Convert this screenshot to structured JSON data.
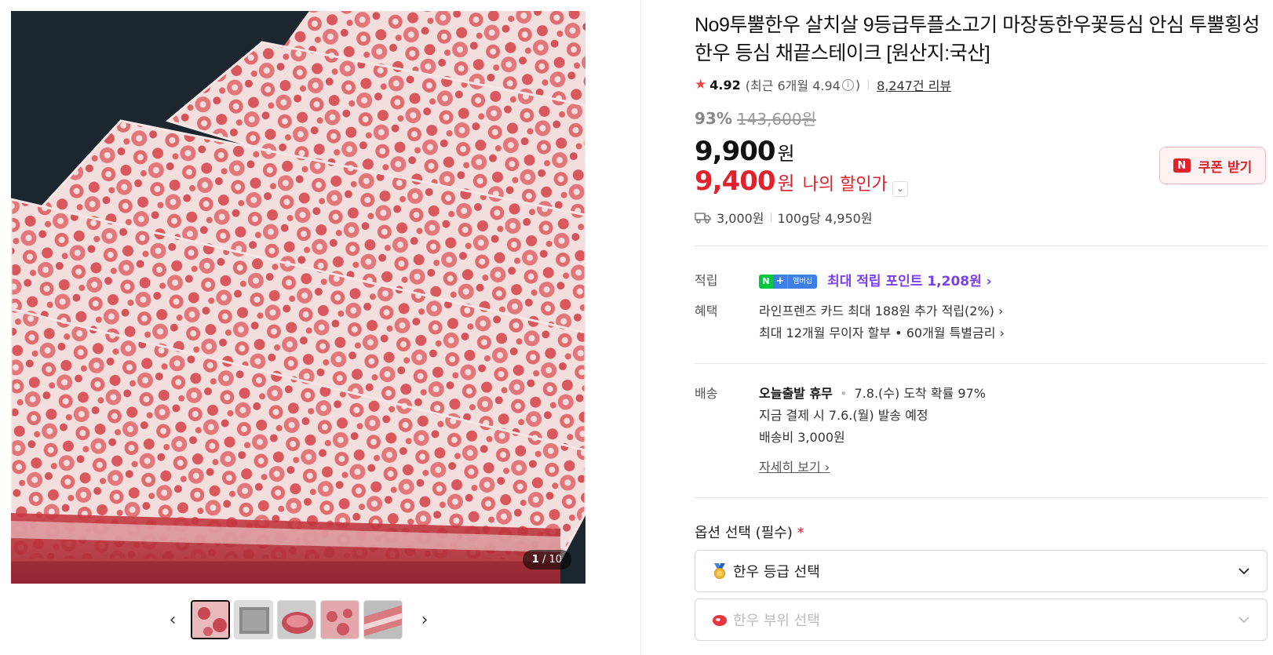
{
  "gallery": {
    "counter_current": "1",
    "counter_total": "/ 10",
    "prev_icon": "chevron-left-icon",
    "next_icon": "chevron-right-icon"
  },
  "product": {
    "title": "No9투뿔한우 살치살 9등급투플소고기 마장동한우꽃등심 안심 투뿔횡성한우 등심 채끝스테이크 [원산지:국산]",
    "rating": "4.92",
    "recent_rating": "(최근 6개월 4.94",
    "recent_close": ")",
    "reviews": "8,247건 리뷰",
    "discount_rate": "93%",
    "original_price": "143,600원",
    "price": "9,900",
    "price_unit": "원",
    "my_price": "9,400",
    "my_price_unit": "원",
    "my_price_label": "나의 할인가",
    "coupon_label": "쿠폰 받기",
    "coupon_mark": "N",
    "shipping_fee": "3,000원",
    "unit_price": "100g당 4,950원"
  },
  "points": {
    "label": "적립",
    "badge_n": "N",
    "badge_plus": "+",
    "badge_member": "멤버십",
    "text": "최대 적립 포인트 1,208원 ›"
  },
  "benefits": {
    "label": "혜택",
    "items": [
      "라인프렌즈 카드 최대 188원 추가 적립(2%) ›",
      "최대 12개월 무이자 할부 • 60개월 특별금리 ›"
    ]
  },
  "shipping": {
    "label": "배송",
    "status": "오늘출발 휴무",
    "arrival": "7.8.(수) 도착 확률 97%",
    "dispatch": "지금 결제 시 7.6.(월) 발송 예정",
    "fee": "배송비 3,000원",
    "detail_link": "자세히 보기 ›"
  },
  "options": {
    "label": "옵션 선택 (필수)",
    "required_mark": "*",
    "select1": "한우 등급 선택",
    "select2": "한우 부위 선택"
  },
  "colors": {
    "accent_red": "#e1212b",
    "points_purple": "#7b3ff2",
    "naver_green": "#00c73c",
    "star": "#f04848"
  }
}
